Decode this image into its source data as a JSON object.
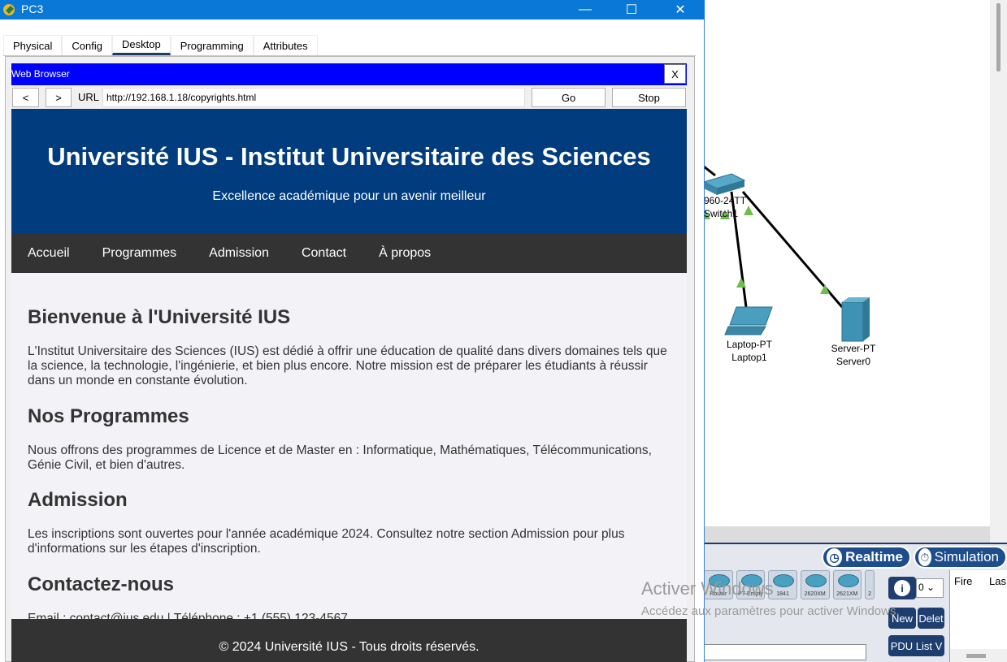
{
  "window": {
    "title": "PC3",
    "tabs": [
      "Physical",
      "Config",
      "Desktop",
      "Programming",
      "Attributes"
    ],
    "active_tab": "Desktop"
  },
  "browser": {
    "title": "Web Browser",
    "close_label": "X",
    "back_label": "<",
    "forward_label": ">",
    "url_label": "URL",
    "url_value": "http://192.168.1.18/copyrights.html",
    "go_label": "Go",
    "stop_label": "Stop"
  },
  "site": {
    "header_title": "Université IUS - Institut Universitaire des Sciences",
    "tagline": "Excellence académique pour un avenir meilleur",
    "nav": [
      "Accueil",
      "Programmes",
      "Admission",
      "Contact",
      "À propos"
    ],
    "sections": [
      {
        "heading": "Bienvenue à l'Université IUS",
        "text": "L'Institut Universitaire des Sciences (IUS) est dédié à offrir une éducation de qualité dans divers domaines tels que la science, la technologie, l'ingénierie, et bien plus encore. Notre mission est de préparer les étudiants à réussir dans un monde en constante évolution."
      },
      {
        "heading": "Nos Programmes",
        "text": "Nous offrons des programmes de Licence et de Master en : Informatique, Mathématiques, Télécommunications, Génie Civil, et bien d'autres."
      },
      {
        "heading": "Admission",
        "text": "Les inscriptions sont ouvertes pour l'année académique 2024. Consultez notre section Admission pour plus d'informations sur les étapes d'inscription."
      },
      {
        "heading": "Contactez-nous",
        "text": "Email : contact@ius.edu | Téléphone : +1 (555) 123-4567"
      }
    ],
    "footer": "© 2024 Université IUS - Tous droits réservés."
  },
  "topology": {
    "switch_label_model": "960-24TT",
    "switch_label_name": "Switch1",
    "laptop_label_model": "Laptop-PT",
    "laptop_label_name": "Laptop1",
    "server_label_model": "Server-PT",
    "server_label_name": "Server0",
    "link_color": "#000000",
    "link_status_color": "#6cc04a"
  },
  "bottom_panel": {
    "realtime_label": "Realtime",
    "simulation_label": "Simulation",
    "device_chips": [
      "Router",
      "PT-Empty",
      "1841",
      "2620XM",
      "2621XM",
      "2"
    ],
    "scenario_value": "0",
    "new_label": "New",
    "delete_label": "Delet",
    "pdu_list_label": "PDU List V",
    "event_headers": [
      "Fire",
      "Las"
    ]
  },
  "watermark": {
    "title": "Activer Windows",
    "subtitle": "Accédez aux paramètres pour activer Windows."
  },
  "colors": {
    "titlebar": "#0a78d7",
    "browser_bar": "#0000ff",
    "site_header": "#003c7e",
    "site_nav": "#333333",
    "accent": "#1e4d8c"
  }
}
